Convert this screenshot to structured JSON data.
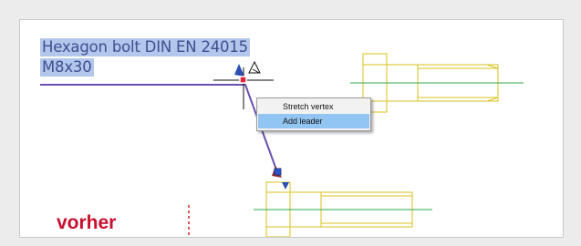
{
  "annotation": {
    "line1": "Hexagon bolt DIN EN 24015",
    "line2": "M8x30"
  },
  "context_menu": {
    "items": [
      "Stretch vertex",
      "Add leader"
    ],
    "highlighted_index": 1
  },
  "caption": "vorher",
  "icons": [
    "cursor-crosshair-icon",
    "snap-tracking-icon",
    "grip-vertex-icon"
  ],
  "colors": {
    "bolt_outline": "#d9c21a",
    "center_line": "#2fa84a",
    "leader": "#6a4fb0",
    "selection_highlight": "#b2c7ec",
    "grip": "#e0243a",
    "caption": "#c8102e",
    "menu_highlight": "#92c5f1"
  }
}
